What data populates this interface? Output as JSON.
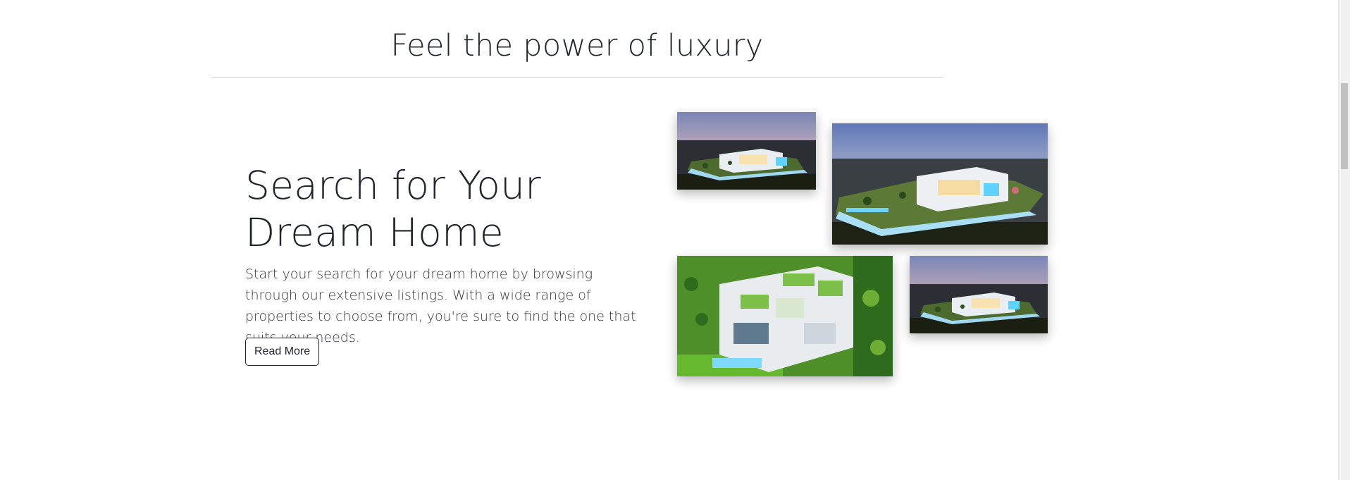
{
  "section": {
    "title": "Feel the power of luxury"
  },
  "hero": {
    "heading": "Search for Your Dream Home",
    "text": "Start your search for your dream home by browsing through our extensive listings. With a wide range of properties to choose from, you're sure to find the one that suits your needs.",
    "button_label": "Read More"
  },
  "gallery": {
    "images": [
      {
        "name": "mansion-dusk-small",
        "subject": "modern mansion at dusk, hillside view"
      },
      {
        "name": "mansion-dusk-large",
        "subject": "modern mansion at dusk, city lights"
      },
      {
        "name": "mansion-aerial-green",
        "subject": "aerial view of mansion with green roofs"
      },
      {
        "name": "mansion-dusk-small-2",
        "subject": "modern mansion at dusk, hillside view"
      }
    ]
  },
  "colors": {
    "text": "#212529",
    "divider": "#cfcfcf",
    "pool_blue": "#4fc3f7",
    "lawn_green": "#6aa84f"
  }
}
